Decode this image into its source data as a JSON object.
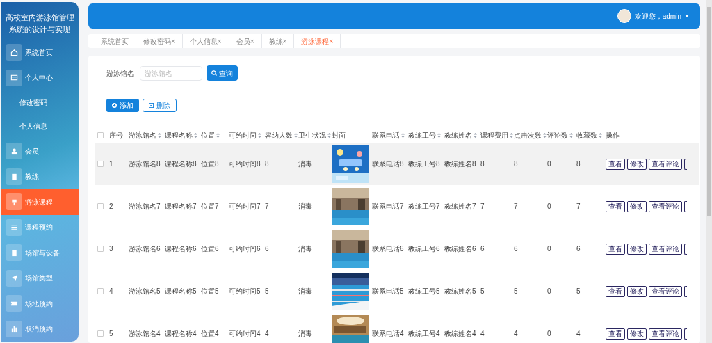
{
  "sidebar": {
    "title": "高校室内游泳馆管理系统的设计与实现",
    "items": [
      {
        "label": "系统首页",
        "selected": false
      },
      {
        "label": "个人中心",
        "selected": false,
        "children": [
          {
            "label": "修改密码"
          },
          {
            "label": "个人信息"
          }
        ]
      },
      {
        "label": "会员",
        "selected": false
      },
      {
        "label": "教练",
        "selected": false
      },
      {
        "label": "游泳课程",
        "selected": true
      },
      {
        "label": "课程预约",
        "selected": false
      },
      {
        "label": "场馆与设备",
        "selected": false
      },
      {
        "label": "场馆类型",
        "selected": false
      },
      {
        "label": "场地预约",
        "selected": false
      },
      {
        "label": "取消预约",
        "selected": false
      }
    ]
  },
  "header": {
    "greeting": "欢迎您，admin"
  },
  "tabs": [
    {
      "label": "系统首页",
      "selected": false
    },
    {
      "label": "修改密码",
      "close": "×",
      "selected": false
    },
    {
      "label": "个人信息",
      "close": "×",
      "selected": false
    },
    {
      "label": "会员",
      "close": "×",
      "selected": false
    },
    {
      "label": "教练",
      "close": "×",
      "selected": false
    },
    {
      "label": "游泳课程",
      "close": "×",
      "selected": true
    }
  ],
  "search": {
    "label": "游泳馆名",
    "placeholder": "游泳馆名",
    "button": "查询"
  },
  "actions": [
    {
      "label": "添加",
      "kind": "primary"
    },
    {
      "label": "删除",
      "kind": "outline"
    }
  ],
  "table": {
    "all_checked": false,
    "columns": [
      {
        "label": "序号",
        "sortable": false
      },
      {
        "label": "游泳馆名",
        "sortable": true
      },
      {
        "label": "课程名称",
        "sortable": true
      },
      {
        "label": "位置",
        "sortable": true
      },
      {
        "label": "可约时间",
        "sortable": true
      },
      {
        "label": "容纳人数",
        "sortable": true
      },
      {
        "label": "卫生状况",
        "sortable": true
      },
      {
        "label": "封面",
        "sortable": false
      },
      {
        "label": "联系电话",
        "sortable": true
      },
      {
        "label": "教练工号",
        "sortable": true
      },
      {
        "label": "教练姓名",
        "sortable": true
      },
      {
        "label": "课程费用",
        "sortable": true
      },
      {
        "label": "点击次数",
        "sortable": true
      },
      {
        "label": "评论数",
        "sortable": true
      },
      {
        "label": "收藏数",
        "sortable": true
      },
      {
        "label": "操作",
        "sortable": false
      }
    ],
    "rows": [
      {
        "hovered": true,
        "checked": false,
        "cells": [
          "1",
          "游泳馆名8",
          "课程名称8",
          "位置8",
          "可约时间8",
          "8",
          "消毒",
          "",
          "联系电话8",
          "教练工号8",
          "教练姓名8",
          "8",
          "8",
          "0",
          "8"
        ],
        "buttons": [
          "查看",
          "修改",
          "查看评论"
        ]
      },
      {
        "hovered": false,
        "checked": false,
        "cells": [
          "2",
          "游泳馆名7",
          "课程名称7",
          "位置7",
          "可约时间7",
          "7",
          "消毒",
          "",
          "联系电话7",
          "教练工号7",
          "教练姓名7",
          "7",
          "7",
          "0",
          "7"
        ],
        "buttons": [
          "查看",
          "修改",
          "查看评论"
        ]
      },
      {
        "hovered": false,
        "checked": false,
        "cells": [
          "3",
          "游泳馆名6",
          "课程名称6",
          "位置6",
          "可约时间6",
          "6",
          "消毒",
          "",
          "联系电话6",
          "教练工号6",
          "教练姓名6",
          "6",
          "6",
          "0",
          "6"
        ],
        "buttons": [
          "查看",
          "修改",
          "查看评论"
        ]
      },
      {
        "hovered": false,
        "checked": false,
        "cells": [
          "4",
          "游泳馆名5",
          "课程名称5",
          "位置5",
          "可约时间5",
          "5",
          "消毒",
          "",
          "联系电话5",
          "教练工号5",
          "教练姓名5",
          "5",
          "5",
          "0",
          "5"
        ],
        "buttons": [
          "查看",
          "修改",
          "查看评论"
        ]
      },
      {
        "hovered": false,
        "checked": false,
        "cells": [
          "5",
          "游泳馆名4",
          "课程名称4",
          "位置4",
          "可约时间4",
          "4",
          "消毒",
          "",
          "联系电话4",
          "教练工号4",
          "教练姓名4",
          "4",
          "4",
          "0",
          "4"
        ],
        "buttons": [
          "查看",
          "修改",
          "查看评论"
        ]
      }
    ]
  }
}
